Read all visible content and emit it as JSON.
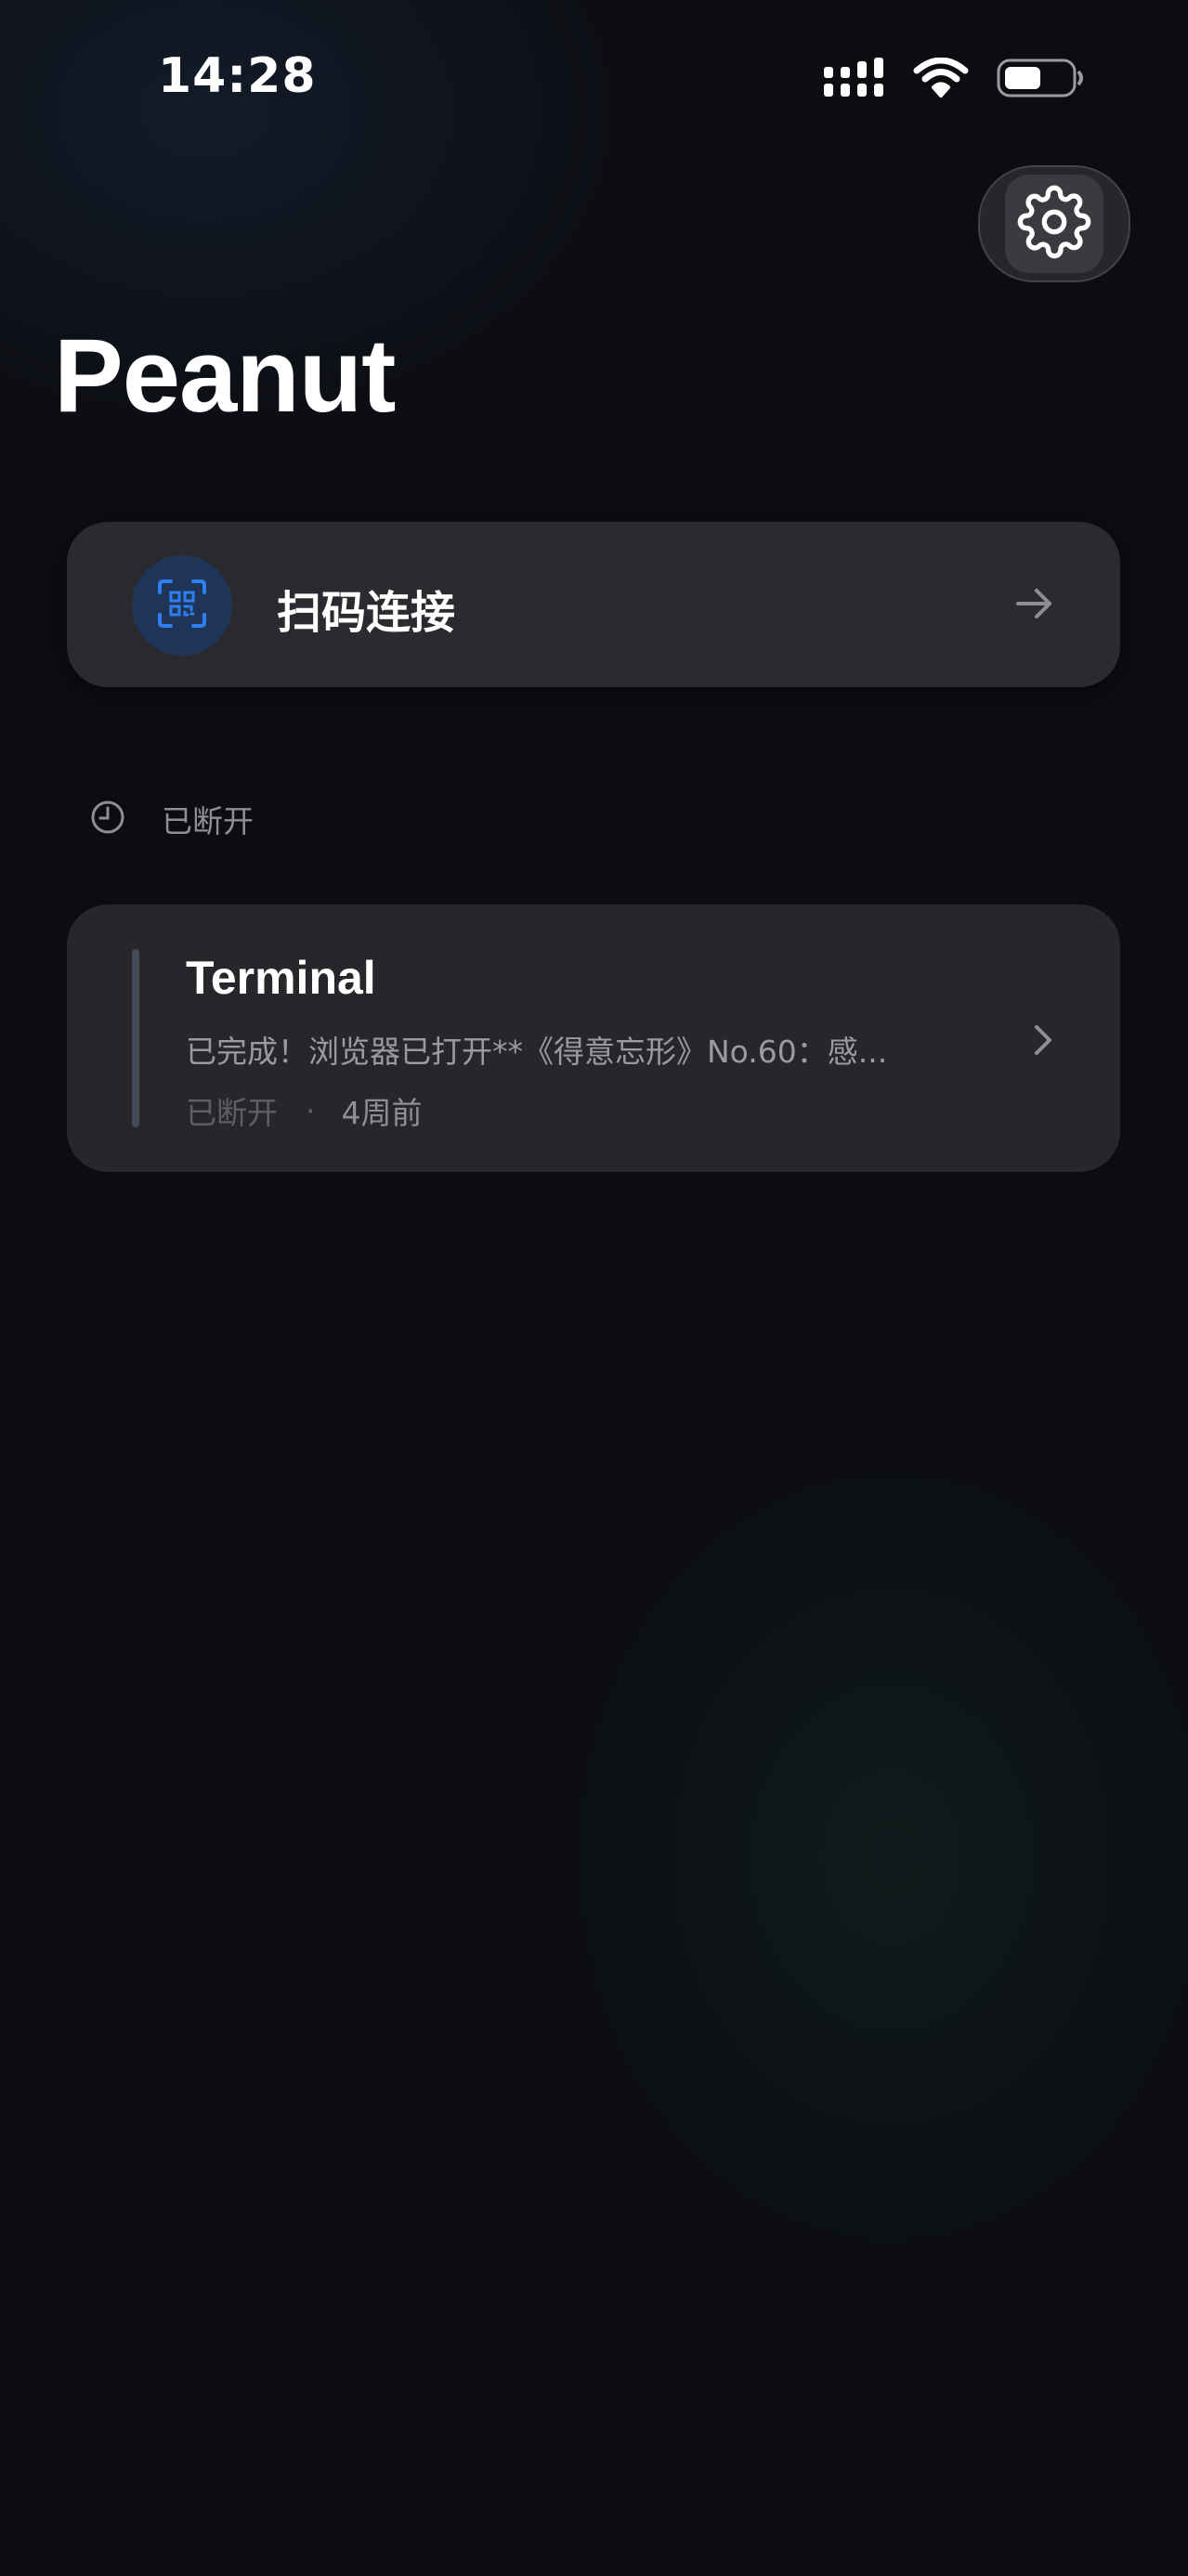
{
  "status_bar": {
    "time": "14:28",
    "icons": [
      "cellular-signal-icon",
      "wifi-icon",
      "battery-icon"
    ]
  },
  "header": {
    "title": "Peanut",
    "settings_icon": "gear-icon"
  },
  "scan_card": {
    "label": "扫码连接",
    "icon": "qr-scan-icon",
    "arrow_icon": "arrow-right-icon"
  },
  "section": {
    "icon": "clock-icon",
    "label": "已断开"
  },
  "sessions": [
    {
      "title": "Terminal",
      "preview": "已完成！浏览器已打开**《得意忘形》No.60：感...",
      "status": "已断开",
      "separator": "·",
      "time": "4周前"
    }
  ],
  "colors": {
    "background": "#0c0c11",
    "card": "#2a2a2f",
    "accent_blue": "#2f7ff0",
    "muted_text": "#8e8e96"
  }
}
